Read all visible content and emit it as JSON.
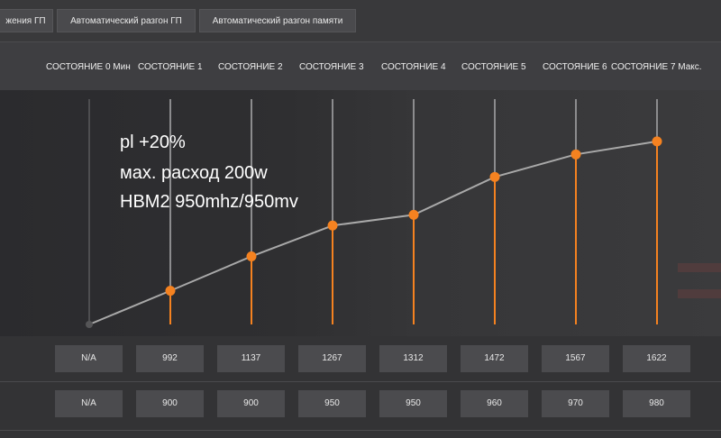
{
  "tabs": [
    {
      "label": "жения ГП"
    },
    {
      "label": "Автоматический разгон ГП"
    },
    {
      "label": "Автоматический разгон памяти"
    }
  ],
  "states": [
    "СОСТОЯНИЕ 0 Мин",
    "СОСТОЯНИЕ 1",
    "СОСТОЯНИЕ 2",
    "СОСТОЯНИЕ 3",
    "СОСТОЯНИЕ 4",
    "СОСТОЯНИЕ 5",
    "СОСТОЯНИЕ 6",
    "СОСТОЯНИЕ 7 Макс."
  ],
  "annotation": {
    "line1": "pl +20%",
    "line2": "мах. расход 200w",
    "line3": "HBM2 950mhz/950mv"
  },
  "frequencies": [
    "N/A",
    "992",
    "1137",
    "1267",
    "1312",
    "1472",
    "1567",
    "1622"
  ],
  "voltages": [
    "N/A",
    "900",
    "900",
    "950",
    "950",
    "960",
    "970",
    "980"
  ],
  "colors": {
    "accent": "#f58220",
    "curve": "#a9a9a9"
  }
}
